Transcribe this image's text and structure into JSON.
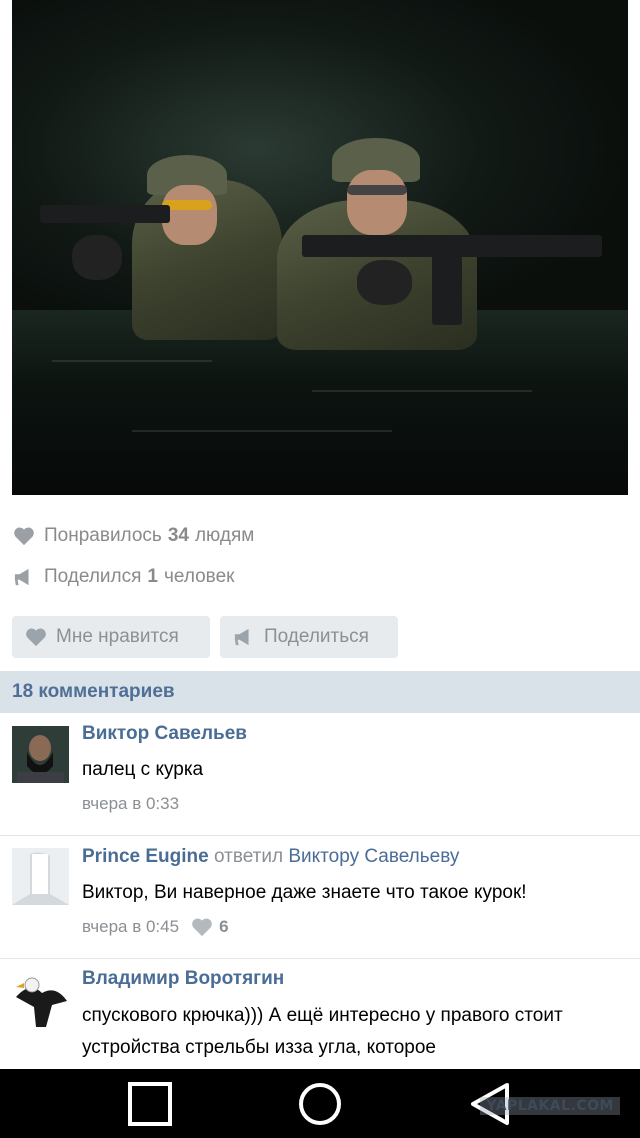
{
  "post": {
    "photo_alt": "soldiers-in-water-photo",
    "likes": {
      "prefix": "Понравилось",
      "count": "34",
      "suffix": "людям"
    },
    "shares": {
      "prefix": "Поделился",
      "count": "1",
      "suffix": "человек"
    },
    "actions": {
      "like_label": "Мне нравится",
      "share_label": "Поделиться"
    }
  },
  "comments_header": "18 комментариев",
  "comments": [
    {
      "author": "Виктор Савельев",
      "reply_word": "",
      "reply_target": "",
      "text": "палец с курка",
      "time": "вчера в 0:33",
      "likes": ""
    },
    {
      "author": "Prince Eugine",
      "reply_word": "ответил",
      "reply_target": "Виктору Савельеву",
      "text": "Виктор, Ви наверное даже знаете что такое курок!",
      "time": "вчера в 0:45",
      "likes": "6"
    },
    {
      "author": "Владимир Воротягин",
      "reply_word": "",
      "reply_target": "",
      "text": "спускового крючка))) А ещё интересно у правого стоит устройства стрельбы изза угла, которое",
      "time": "",
      "likes": ""
    }
  ],
  "navbar": {
    "watermark": "YAPLAKAL.COM"
  },
  "colors": {
    "link_blue": "#4a6d96",
    "header_bg": "#dae2e9",
    "muted_gray": "#8a8a8a"
  }
}
